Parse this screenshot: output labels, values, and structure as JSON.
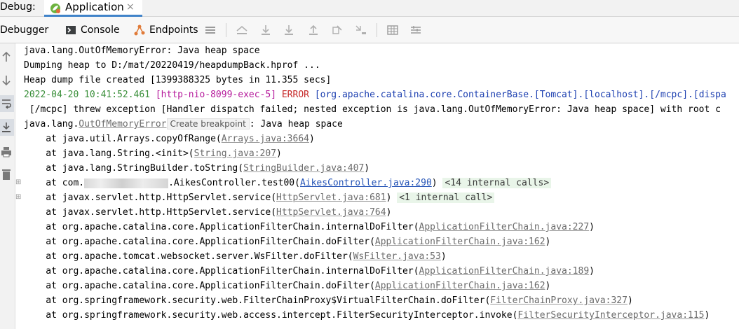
{
  "tabbar": {
    "debug_label": "Debug:",
    "app_tab": "Application",
    "close": "×"
  },
  "toolbar": {
    "debugger": "Debugger",
    "console": "Console",
    "endpoints": "Endpoints"
  },
  "console": {
    "l1": "java.lang.OutOfMemoryError: Java heap space",
    "l2": "Dumping heap to D:/mat/20220419/heapdumpBack.hprof ...",
    "l3": "Heap dump file created [1399388325 bytes in 11.355 secs]",
    "l4_ts": "2022-04-20 10:41:52.461",
    "l4_thread": "[http-nio-8099-exec-5]",
    "l4_level": "ERROR",
    "l4_logger": "[org.apache.catalina.core.ContainerBase.[Tomcat].[localhost].[/mcpc].[dispa",
    "l5": " [/mcpc] threw exception [Handler dispatch failed; nested exception is java.lang.OutOfMemoryError: Java heap space] with root c",
    "l6_pre": "java.lang.",
    "l6_link": "OutOfMemoryError",
    "l6_tooltip": "Create breakpoint",
    "l6_post": ": Java heap space",
    "frames": [
      {
        "pre": "    at java.util.Arrays.copyOfRange(",
        "link": "Arrays.java:3664",
        "post": ")"
      },
      {
        "pre": "    at java.lang.String.<init>(",
        "link": "String.java:207",
        "post": ")"
      },
      {
        "pre": "    at java.lang.StringBuilder.toString(",
        "link": "StringBuilder.java:407",
        "post": ")"
      },
      {
        "pre": "    at com.",
        "mid": ".AikesController.test00(",
        "link": "AikesController.java:290",
        "post": ") ",
        "internal": "<14 internal calls>"
      },
      {
        "pre": "    at javax.servlet.http.HttpServlet.service(",
        "link": "HttpServlet.java:681",
        "post": ") ",
        "internal": "<1 internal call>"
      },
      {
        "pre": "    at javax.servlet.http.HttpServlet.service(",
        "link": "HttpServlet.java:764",
        "post": ")"
      },
      {
        "pre": "    at org.apache.catalina.core.ApplicationFilterChain.internalDoFilter(",
        "link": "ApplicationFilterChain.java:227",
        "post": ")"
      },
      {
        "pre": "    at org.apache.catalina.core.ApplicationFilterChain.doFilter(",
        "link": "ApplicationFilterChain.java:162",
        "post": ")"
      },
      {
        "pre": "    at org.apache.tomcat.websocket.server.WsFilter.doFilter(",
        "link": "WsFilter.java:53",
        "post": ")"
      },
      {
        "pre": "    at org.apache.catalina.core.ApplicationFilterChain.internalDoFilter(",
        "link": "ApplicationFilterChain.java:189",
        "post": ")"
      },
      {
        "pre": "    at org.apache.catalina.core.ApplicationFilterChain.doFilter(",
        "link": "ApplicationFilterChain.java:162",
        "post": ")"
      },
      {
        "pre": "    at org.springframework.security.web.FilterChainProxy$VirtualFilterChain.doFilter(",
        "link": "FilterChainProxy.java:327",
        "post": ")"
      },
      {
        "pre": "    at org.springframework.security.web.access.intercept.FilterSecurityInterceptor.invoke(",
        "link": "FilterSecurityInterceptor.java:115",
        "post": ")"
      }
    ]
  },
  "icons": {
    "app": "spring-icon",
    "console": "console-icon",
    "endpoints": "endpoints-icon"
  }
}
